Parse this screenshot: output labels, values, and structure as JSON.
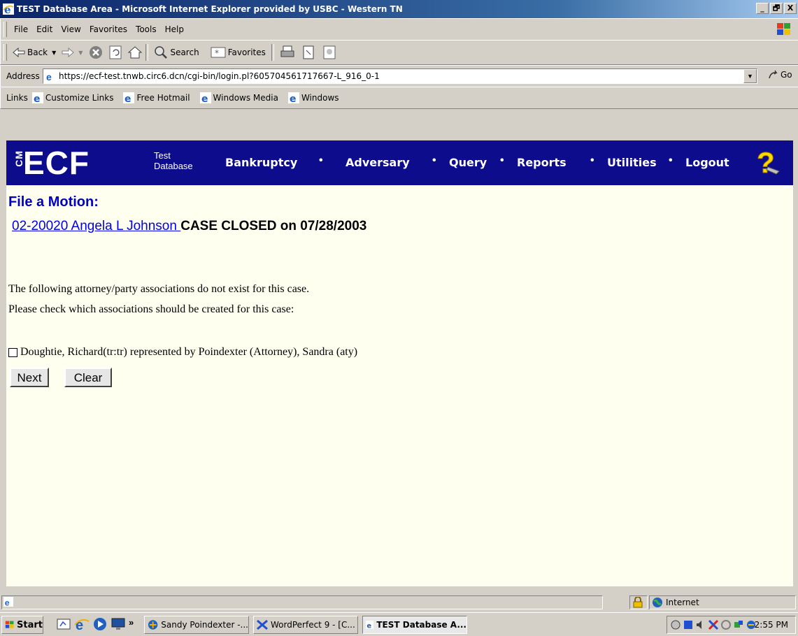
{
  "window": {
    "title": "TEST Database Area - Microsoft Internet Explorer provided by USBC - Western TN",
    "controls": [
      "_",
      "🗗",
      "X"
    ]
  },
  "menu": [
    "File",
    "Edit",
    "View",
    "Favorites",
    "Tools",
    "Help"
  ],
  "toolbar": {
    "back": "Back",
    "search": "Search",
    "favorites": "Favorites"
  },
  "address": {
    "label": "Address",
    "url": "https://ecf-test.tnwb.circ6.dcn/cgi-bin/login.pl?605704561717667-L_916_0-1",
    "go": "Go"
  },
  "links": {
    "label": "Links",
    "items": [
      "Customize Links",
      "Free Hotmail",
      "Windows Media",
      "Windows"
    ]
  },
  "ecf": {
    "logo": "ECF",
    "logo_prefix": "CM",
    "test_line1": "Test",
    "test_line2": "Database",
    "nav": [
      "Bankruptcy",
      "Adversary",
      "Query",
      "Reports",
      "Utilities",
      "Logout"
    ],
    "separator": "•"
  },
  "page": {
    "heading": "File a Motion:",
    "case_link": "02-20020 Angela L Johnson ",
    "case_status": "CASE CLOSED on 07/28/2003",
    "line1": "The following attorney/party associations do not exist for this case.",
    "line2": "Please check which associations should be created for this case:",
    "association": "Doughtie, Richard(tr:tr) represented by Poindexter (Attorney), Sandra (aty)",
    "association_checked": false,
    "next_button": "Next",
    "clear_button": "Clear"
  },
  "statusbar": {
    "zone": "Internet"
  },
  "taskbar": {
    "start": "Start",
    "chevron": "»",
    "tasks": [
      "Sandy Poindexter -...",
      "WordPerfect 9 - [C...",
      "TEST Database A..."
    ],
    "clock": "2:55 PM"
  },
  "colors": {
    "title_gradient_start": "#0a246a",
    "nav_background": "#0c0c8c",
    "heading_blue": "#0000c0",
    "link_blue": "#0000ee",
    "content_background": "#fffff0"
  }
}
